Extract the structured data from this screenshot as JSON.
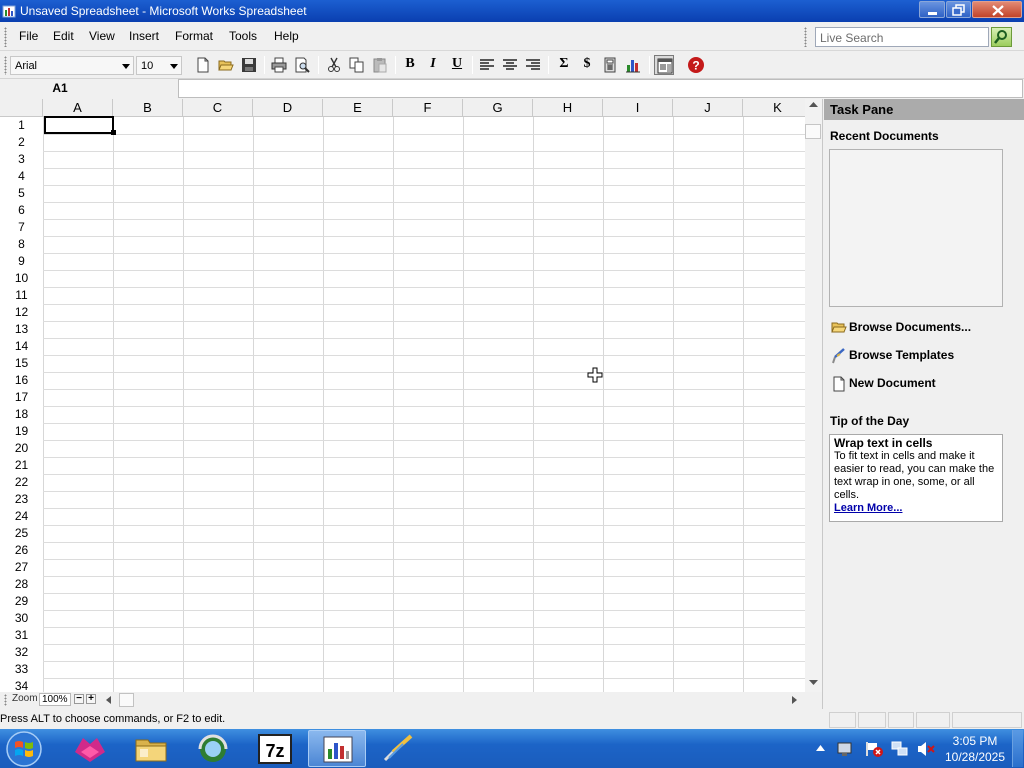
{
  "window": {
    "title": "Unsaved Spreadsheet - Microsoft Works Spreadsheet"
  },
  "menu": {
    "items": [
      "File",
      "Edit",
      "View",
      "Insert",
      "Format",
      "Tools",
      "Help"
    ]
  },
  "search": {
    "placeholder": "Live Search"
  },
  "toolbar": {
    "font": "Arial",
    "size": "10",
    "bold": "B",
    "italic": "I",
    "underline": "U",
    "sum": "Σ",
    "currency": "$"
  },
  "formula": {
    "cell_ref": "A1",
    "value": ""
  },
  "grid": {
    "columns": [
      "A",
      "B",
      "C",
      "D",
      "E",
      "F",
      "G",
      "H",
      "I",
      "J",
      "K"
    ],
    "rows": [
      "1",
      "2",
      "3",
      "4",
      "5",
      "6",
      "7",
      "8",
      "9",
      "10",
      "11",
      "12",
      "13",
      "14",
      "15",
      "16",
      "17",
      "18",
      "19",
      "20",
      "21",
      "22",
      "23",
      "24",
      "25",
      "26",
      "27",
      "28",
      "29",
      "30",
      "31",
      "32",
      "33",
      "34"
    ],
    "selected_cell": "A1"
  },
  "zoom": {
    "label": "Zoom",
    "value": "100%",
    "minus": "−",
    "plus": "+"
  },
  "task_pane": {
    "title": "Task Pane",
    "recent_heading": "Recent Documents",
    "links": [
      {
        "label": "Browse Documents...",
        "icon": "folder-open-icon"
      },
      {
        "label": "Browse Templates",
        "icon": "template-brush-icon"
      },
      {
        "label": "New Document",
        "icon": "new-document-icon"
      }
    ],
    "tip_heading": "Tip of the Day",
    "tip": {
      "title": "Wrap text in cells",
      "body": "To fit text in cells and make it easier to read, you can make the text wrap in one, some, or all cells.",
      "link": "Learn More..."
    }
  },
  "status": {
    "text": "Press ALT to choose commands, or F2 to edit."
  },
  "taskbar": {
    "apps": [
      "firefox-icon",
      "explorer-icon",
      "browser-icon",
      "7zip-icon",
      "works-spreadsheet-icon",
      "paint-icon"
    ],
    "zip_label": "7z",
    "time": "3:05 PM",
    "date": "10/28/2025"
  },
  "colors": {
    "titlebar": "#0a3fb0",
    "taskbar": "#1a5cbc",
    "task_pane_header": "#ababab",
    "link": "#0000aa"
  }
}
